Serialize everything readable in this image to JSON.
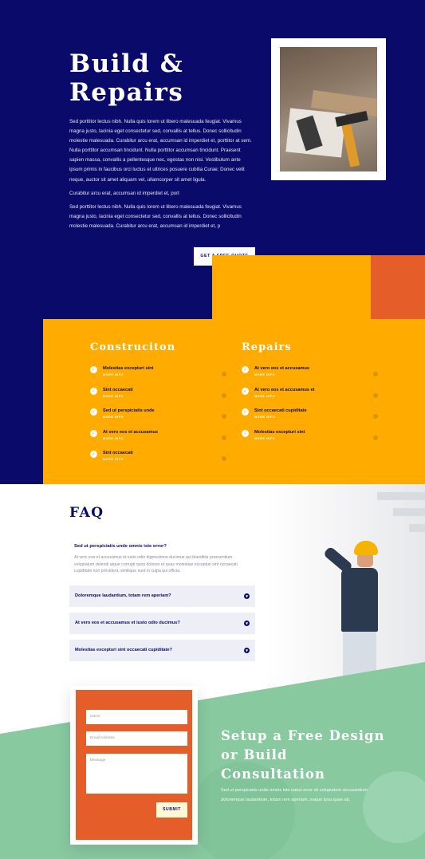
{
  "colors": {
    "navy": "#0a0a6b",
    "yellow": "#ffab00",
    "orange": "#e55e29",
    "green": "#88c9a0"
  },
  "hero": {
    "title_line1": "Build &",
    "title_line2": "Repairs",
    "paragraph1": "Sed porttitor lectus nibh. Nulla quis lorem ut libero malesuada feugiat. Vivamus magna justo, lacinia eget consectetur sed, convallis at tellus. Donec sollicitudin molestie malesuada. Curabitur arcu erat, accumsan id imperdiet et, porttitor at sem. Nulla porttitor accumsan tincidunt. Nulla porttitor accumsan tincidunt. Praesent sapien massa, convallis a pellentesque nec, egestas non nisi. Vestibulum ante ipsum primis in faucibus orci luctus et ultrices posuere cubilia Curae; Donec velit neque, auctor sit amet aliquam vel, ullamcorper sit amet ligula.",
    "paragraph2": "Curabitur arcu erat, accumsan id imperdiet et, port",
    "paragraph3": "Sed porttitor lectus nibh. Nulla quis lorem ut libero malesuada feugiat. Vivamus magna justo, lacinia eget consectetur sed, convallis at tellus. Donec sollicitudin molestie malesuada. Curabitur arcu erat, accumsan id imperdiet et, p",
    "button": "GET A FREE QUOTE"
  },
  "services": {
    "construction": {
      "title": "Construciton",
      "items": [
        {
          "name": "Molestias excepturi sint",
          "more": "MORE INFO"
        },
        {
          "name": "Sint occaecati",
          "more": "MORE INFO"
        },
        {
          "name": "Sed ut perspiciatis unde",
          "more": "MORE INFO"
        },
        {
          "name": "At vero eos et accusamus",
          "more": "MORE INFO"
        },
        {
          "name": "Sint occaecati",
          "more": "MORE INFO"
        }
      ]
    },
    "repairs": {
      "title": "Repairs",
      "items": [
        {
          "name": "At vero eos et accusamus",
          "more": "MORE INFO"
        },
        {
          "name": "At vero eos et accusamus et",
          "more": "MORE INFO"
        },
        {
          "name": "Sint occaecati cupiditate",
          "more": "MORE INFO"
        },
        {
          "name": "Molestias excepturi sint",
          "more": "MORE INFO"
        }
      ]
    }
  },
  "faq": {
    "title": "FAQ",
    "open_question": "Sed ut perspiciatis unde omnis iste error?",
    "open_answer": "At vero eos et accusamus et iusto odio dignissimos ducimus qui blanditiis praesentium voluptatum deleniti atque corrupti quos dolores et quas molestias excepturi sint occaecati cupiditate non provident, similique sunt in culpa qui officia.",
    "items": [
      "Doloremque laudantium, totam rem aperiam?",
      "At vero eos et accusamus et iusto odio ducimus?",
      "Molestias excepturi sint occaecati cupiditate?"
    ]
  },
  "contact": {
    "name_placeholder": "Name",
    "email_placeholder": "Email Address",
    "message_placeholder": "Message",
    "submit": "SUBMIT",
    "title": "Setup a Free Design or Build Consultation",
    "text": "Sed ut perspiciatis unde omnis iste natus error sit voluptatem accusantium doloremque laudantium, totam rem aperiam, eaque ipsa quae ab."
  }
}
